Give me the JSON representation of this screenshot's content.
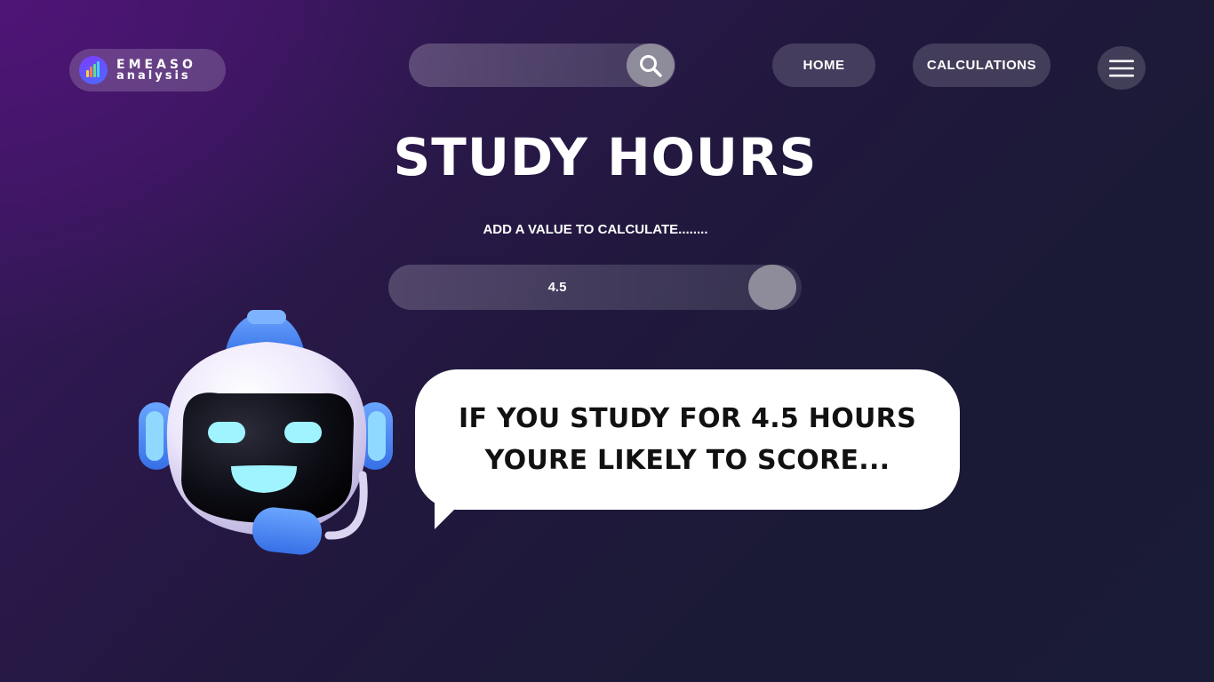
{
  "brand": {
    "name": "EMEASO",
    "sub": "analysis"
  },
  "search": {
    "value": "",
    "placeholder": "",
    "icon": "search-icon"
  },
  "nav": {
    "home_label": "HOME",
    "calculations_label": "CALCULATIONS",
    "menu_icon": "hamburger-menu-icon"
  },
  "page": {
    "title": "STUDY HOURS",
    "subtitle": "ADD A VALUE TO CALCULATE........"
  },
  "slider": {
    "value_text": "4.5",
    "value": 4.5
  },
  "message": {
    "line1": "IF YOU STUDY FOR 4.5 HOURS",
    "line2": "YOURE LIKELY TO SCORE..."
  },
  "colors": {
    "background_dark": "#1b1a36",
    "background_purple": "#4f1477",
    "control_fill": "#8e8b9a",
    "bubble": "#ffffff",
    "robot_accent_blue": "#4d8bf5",
    "robot_face_cyan": "#9ff4ff"
  }
}
